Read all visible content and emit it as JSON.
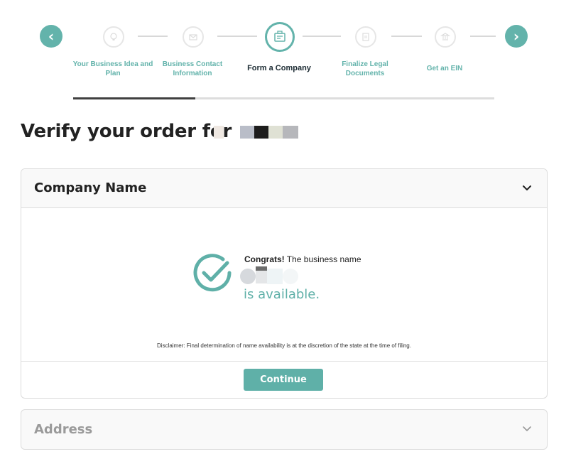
{
  "stepper": {
    "prev_label": "‹",
    "next_label": "›",
    "steps": [
      {
        "label": "Your Business Idea and Plan",
        "icon": "lightbulb-icon",
        "active": false
      },
      {
        "label": "Business Contact Information",
        "icon": "envelope-icon",
        "active": false
      },
      {
        "label": "Form a Company",
        "icon": "briefcase-form-icon",
        "active": true
      },
      {
        "label": "Finalize Legal Documents",
        "icon": "document-icon",
        "active": false
      },
      {
        "label": "Get an EIN",
        "icon": "bank-icon",
        "active": false
      }
    ],
    "progress_fraction": 0.29
  },
  "page": {
    "title": "Verify your order for"
  },
  "company_card": {
    "title": "Company Name",
    "congrats_bold": "Congrats!",
    "congrats_rest": " The business name",
    "available_text": "is available.",
    "disclaimer": "Disclaimer: Final determination of name availability is at the discretion of the state at the time of filing.",
    "continue_label": "Continue"
  },
  "address_card": {
    "title": "Address"
  },
  "colors": {
    "accent": "#63b3ab",
    "progress": "#404040"
  }
}
